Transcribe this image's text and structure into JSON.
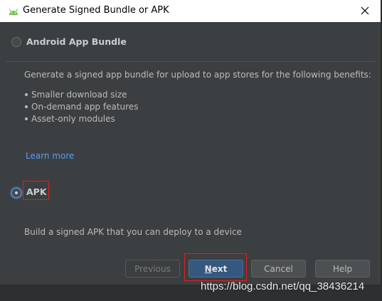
{
  "window": {
    "title": "Generate Signed Bundle or APK",
    "title_icon": "android-icon",
    "close_glyph": "✕"
  },
  "options": {
    "aab": {
      "label": "Android App Bundle",
      "selected": false,
      "description": "Generate a signed app bundle for upload to app stores for the following benefits:",
      "benefits": [
        "Smaller download size",
        "On-demand app features",
        "Asset-only modules"
      ],
      "learn_more": "Learn more"
    },
    "apk": {
      "label": "APK",
      "selected": true,
      "description": "Build a signed APK that you can deploy to a device"
    }
  },
  "buttons": {
    "previous": "Previous",
    "next_mnemonic": "N",
    "next_rest": "ext",
    "cancel": "Cancel",
    "help": "Help"
  },
  "watermark": "https://blog.csdn.net/qq_38436214",
  "colors": {
    "dialog_bg": "#3c3f41",
    "accent_link": "#589df6",
    "primary_button": "#365880",
    "highlight": "#e02020",
    "android_green": "#78c257"
  }
}
